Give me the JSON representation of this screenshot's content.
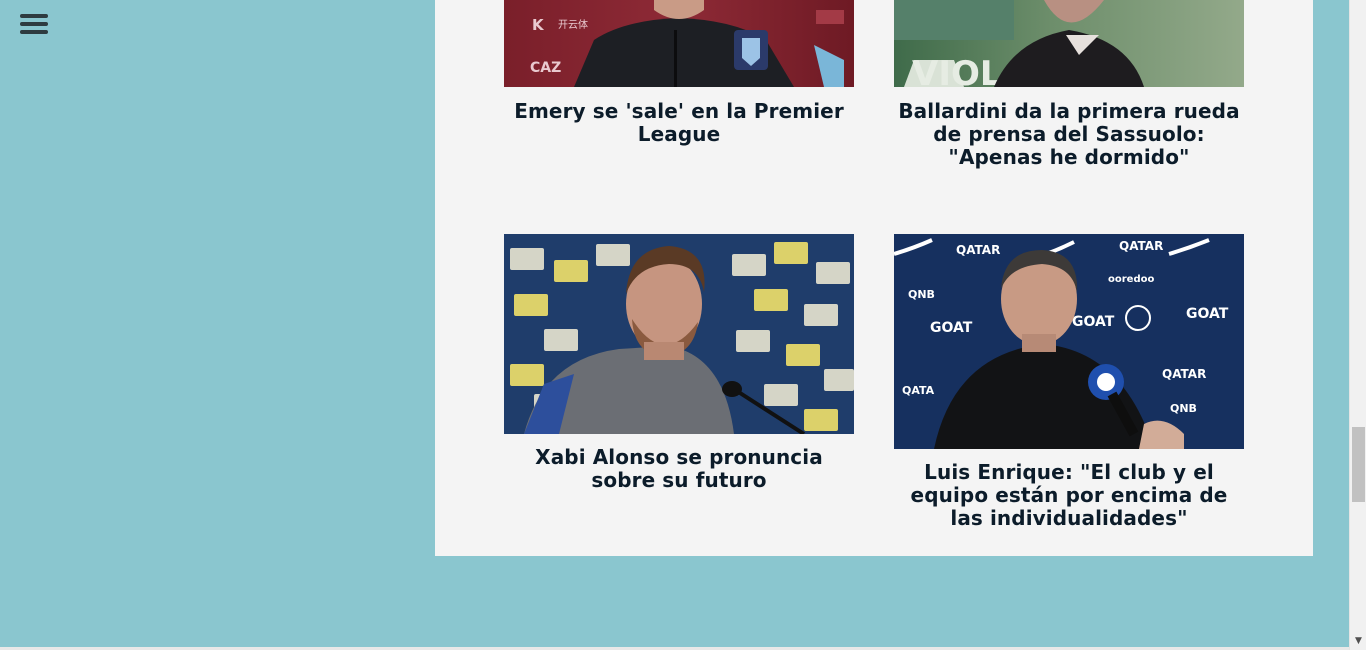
{
  "menu": {
    "icon": "hamburger-menu-icon"
  },
  "articles": [
    {
      "headline": "Emery se 'sale' en la Premier League",
      "image_desc": "coach at press conference, maroon background"
    },
    {
      "headline": "Ballardini da la primera rueda de prensa del Sassuolo: \"Apenas he dormido\"",
      "image_desc": "coach in dark sweater, green background"
    },
    {
      "headline": "Xabi Alonso se pronuncia sobre su futuro",
      "image_desc": "coach at press conference, sponsor wall"
    },
    {
      "headline": "Luis Enrique: \"El club y el equipo están por encima de las individualidades\"",
      "image_desc": "coach interview, navy sponsor wall"
    }
  ],
  "colors": {
    "background": "#8ac6cf",
    "panel": "#f4f4f4",
    "headline": "#0c1c2a"
  }
}
